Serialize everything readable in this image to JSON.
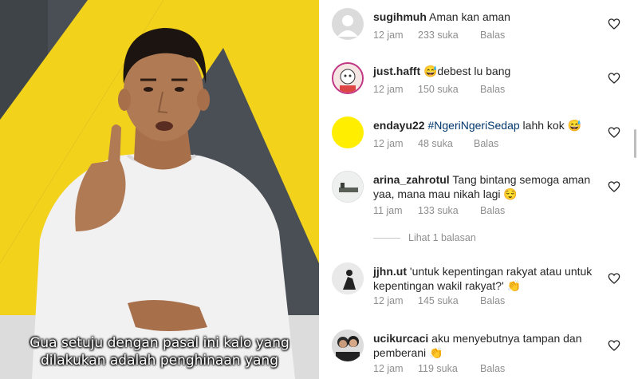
{
  "video": {
    "subtitle_line1": "Gua setuju dengan pasal ini kalo yang",
    "subtitle_line2": "dilakukan adalah penghinaan yang",
    "colors": {
      "background": "#4a4f55",
      "triangle": "#f2d21b",
      "shirt": "#f2f2f2",
      "skin": "#b07a55"
    }
  },
  "comments": [
    {
      "username": "sugihmuh",
      "text": "Aman kan aman",
      "time": "12 jam",
      "likes": "233 suka",
      "reply": "Balas",
      "avatar": "default-avatar-icon"
    },
    {
      "username": "just.hafft",
      "text": "😅debest lu bang",
      "time": "12 jam",
      "likes": "150 suka",
      "reply": "Balas",
      "avatar": "cartoon-avatar-icon"
    },
    {
      "username": "endayu22",
      "hashtag": "#NgeriNgeriSedap",
      "text": " lahh kok 😅",
      "time": "12 jam",
      "likes": "48 suka",
      "reply": "Balas",
      "avatar": "yellow-circle-avatar"
    },
    {
      "username": "arina_zahrotul",
      "text": "Tang bintang semoga aman yaa,  mana mau nikah lagi 😌",
      "time": "11 jam",
      "likes": "133 suka",
      "reply": "Balas",
      "avatar": "landscape-avatar"
    },
    {
      "username": "jjhn.ut",
      "text": "'untuk kepentingan rakyat atau untuk kepentingan wakil rakyat?' 👏",
      "time": "12 jam",
      "likes": "145 suka",
      "reply": "Balas",
      "avatar": "silhouette-avatar"
    },
    {
      "username": "ucikurcaci",
      "text": "aku menyebutnya tampan dan pemberani 👏",
      "time": "12 jam",
      "likes": "119 suka",
      "reply": "Balas",
      "avatar": "couple-avatar"
    }
  ],
  "view_replies": "Lihat 1 balasan",
  "accent_colors": {
    "meta_text": "#8e8e8e",
    "hashtag": "#00376b",
    "username": "#262626"
  }
}
